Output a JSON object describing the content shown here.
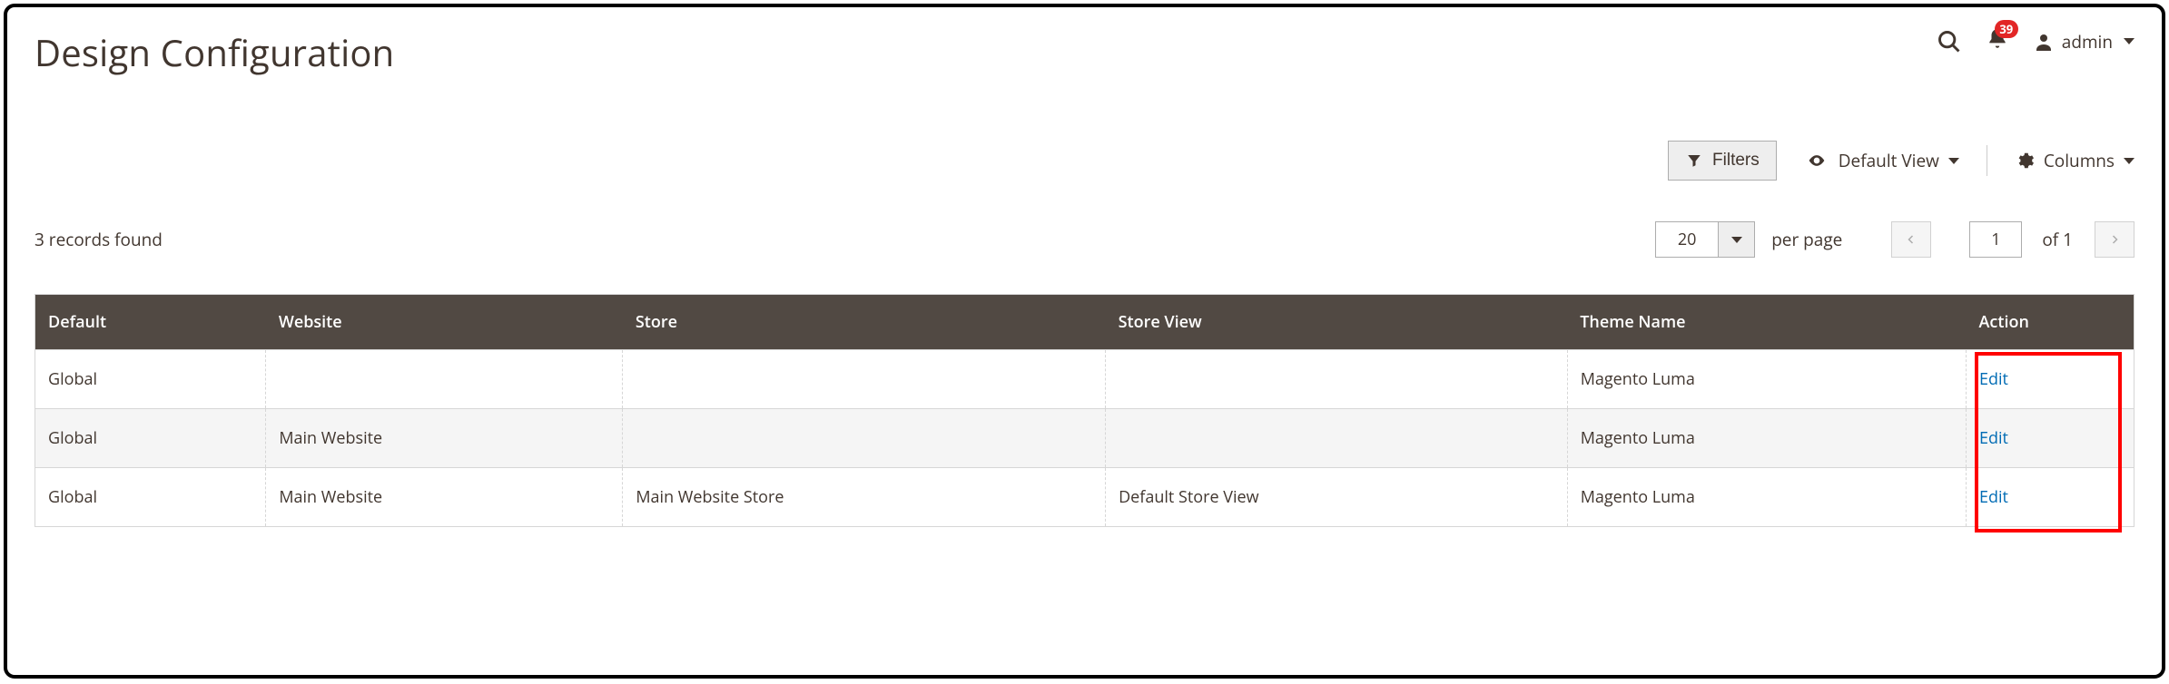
{
  "header": {
    "title": "Design Configuration",
    "notification_count": "39",
    "username": "admin"
  },
  "toolbar": {
    "filters_label": "Filters",
    "view_label": "Default View",
    "columns_label": "Columns"
  },
  "paging": {
    "records_found": "3 records found",
    "page_size": "20",
    "per_page_label": "per page",
    "current_page": "1",
    "of_label": "of",
    "total_pages": "1"
  },
  "table": {
    "columns": [
      "Default",
      "Website",
      "Store",
      "Store View",
      "Theme Name",
      "Action"
    ],
    "rows": [
      {
        "default": "Global",
        "website": "",
        "store": "",
        "store_view": "",
        "theme_name": "Magento Luma",
        "action": "Edit"
      },
      {
        "default": "Global",
        "website": "Main Website",
        "store": "",
        "store_view": "",
        "theme_name": "Magento Luma",
        "action": "Edit"
      },
      {
        "default": "Global",
        "website": "Main Website",
        "store": "Main Website Store",
        "store_view": "Default Store View",
        "theme_name": "Magento Luma",
        "action": "Edit"
      }
    ]
  }
}
